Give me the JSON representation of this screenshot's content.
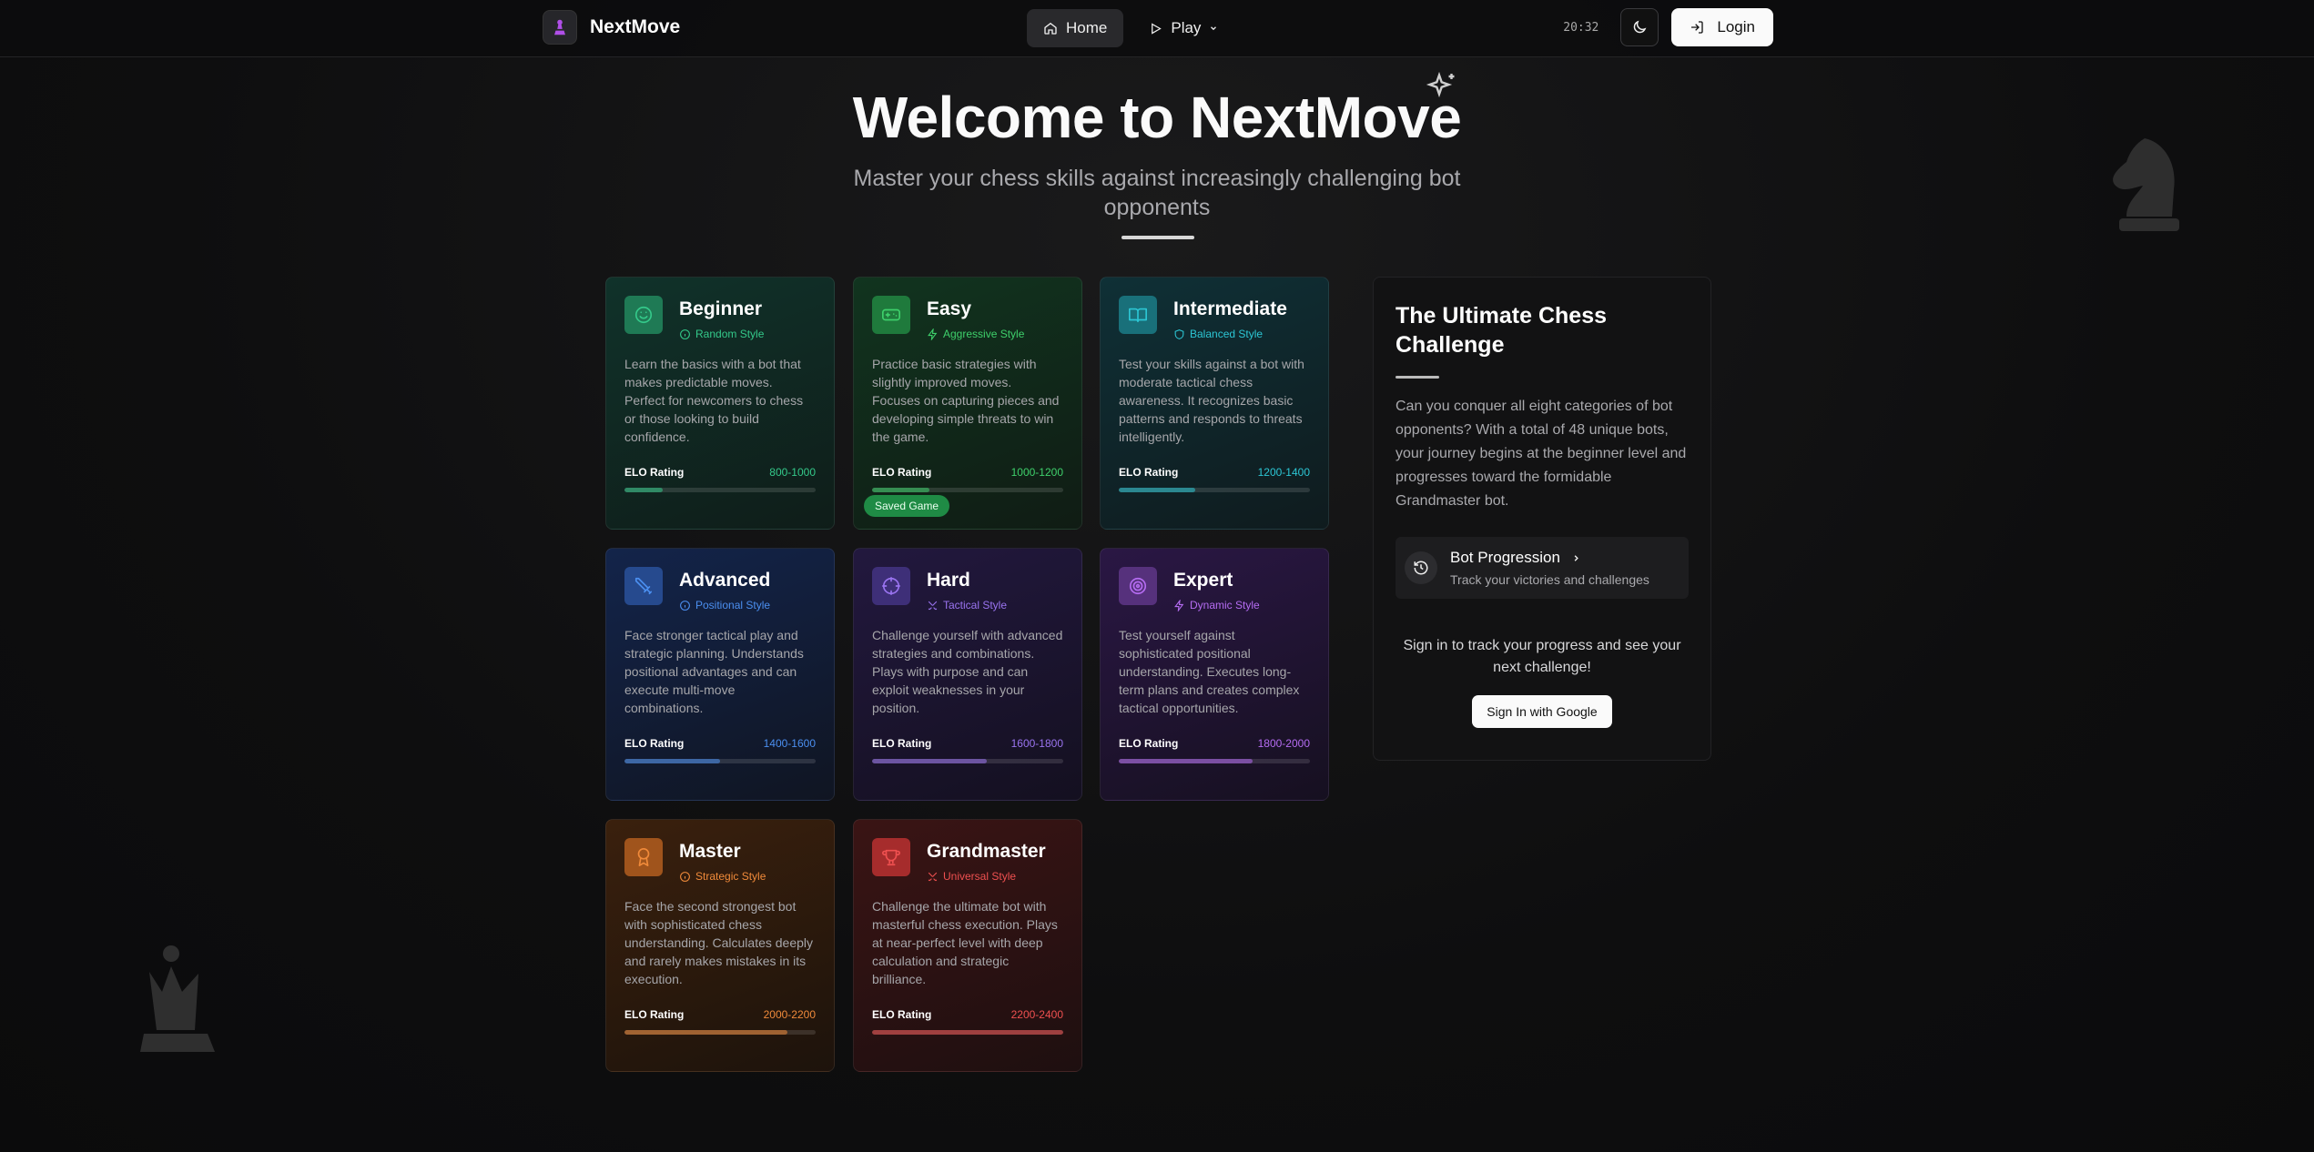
{
  "nav": {
    "brand": "NextMove",
    "home_label": "Home",
    "play_label": "Play",
    "time": "20:32",
    "login_label": "Login"
  },
  "hero": {
    "title": "Welcome to NextMove",
    "subtitle": "Master your chess skills against increasingly challenging bot opponents"
  },
  "elo_label": "ELO Rating",
  "bots": [
    {
      "name": "Beginner",
      "style": "Random Style",
      "desc": "Learn the basics with a bot that makes predictable moves. Perfect for newcomers to chess or those looking to build confidence.",
      "elo": "800-1000",
      "progress": 0.2,
      "accent": "#34c98a"
    },
    {
      "name": "Easy",
      "style": "Aggressive Style",
      "desc": "Practice basic strategies with slightly improved moves. Focuses on capturing pieces and developing simple threats to win the game.",
      "elo": "1000-1200",
      "progress": 0.3,
      "accent": "#3ed06b"
    },
    {
      "name": "Intermediate",
      "style": "Balanced Style",
      "desc": "Test your skills against a bot with moderate tactical chess awareness. It recognizes basic patterns and responds to threats intelligently.",
      "elo": "1200-1400",
      "progress": 0.4,
      "accent": "#2cc6d4"
    },
    {
      "name": "Advanced",
      "style": "Positional Style",
      "desc": "Face stronger tactical play and strategic planning. Understands positional advantages and can execute multi-move combinations.",
      "elo": "1400-1600",
      "progress": 0.5,
      "accent": "#4b8ff0"
    },
    {
      "name": "Hard",
      "style": "Tactical Style",
      "desc": "Challenge yourself with advanced strategies and combinations. Plays with purpose and can exploit weaknesses in your position.",
      "elo": "1600-1800",
      "progress": 0.6,
      "accent": "#9a74f0"
    },
    {
      "name": "Expert",
      "style": "Dynamic Style",
      "desc": "Test yourself against sophisticated positional understanding. Executes long-term plans and creates complex tactical opportunities.",
      "elo": "1800-2000",
      "progress": 0.7,
      "accent": "#b56cf2"
    },
    {
      "name": "Master",
      "style": "Strategic Style",
      "desc": "Face the second strongest bot with sophisticated chess understanding. Calculates deeply and rarely makes mistakes in its execution.",
      "elo": "2000-2200",
      "progress": 0.85,
      "accent": "#f08a3a"
    },
    {
      "name": "Grandmaster",
      "style": "Universal Style",
      "desc": "Challenge the ultimate bot with masterful chess execution. Plays at near-perfect level with deep calculation and strategic brilliance.",
      "elo": "2200-2400",
      "progress": 1.0,
      "accent": "#ef5050"
    }
  ],
  "saved_badge": "Saved Game",
  "panel": {
    "title": "The Ultimate Chess Challenge",
    "text": "Can you conquer all eight categories of bot opponents? With a total of 48 unique bots, your journey begins at the beginner level and progresses toward the formidable Grandmaster bot.",
    "progress_title": "Bot Progression",
    "progress_sub": "Track your victories and challenges",
    "cta": "Sign in to track your progress and see your next challenge!",
    "google_label": "Sign In with Google"
  }
}
